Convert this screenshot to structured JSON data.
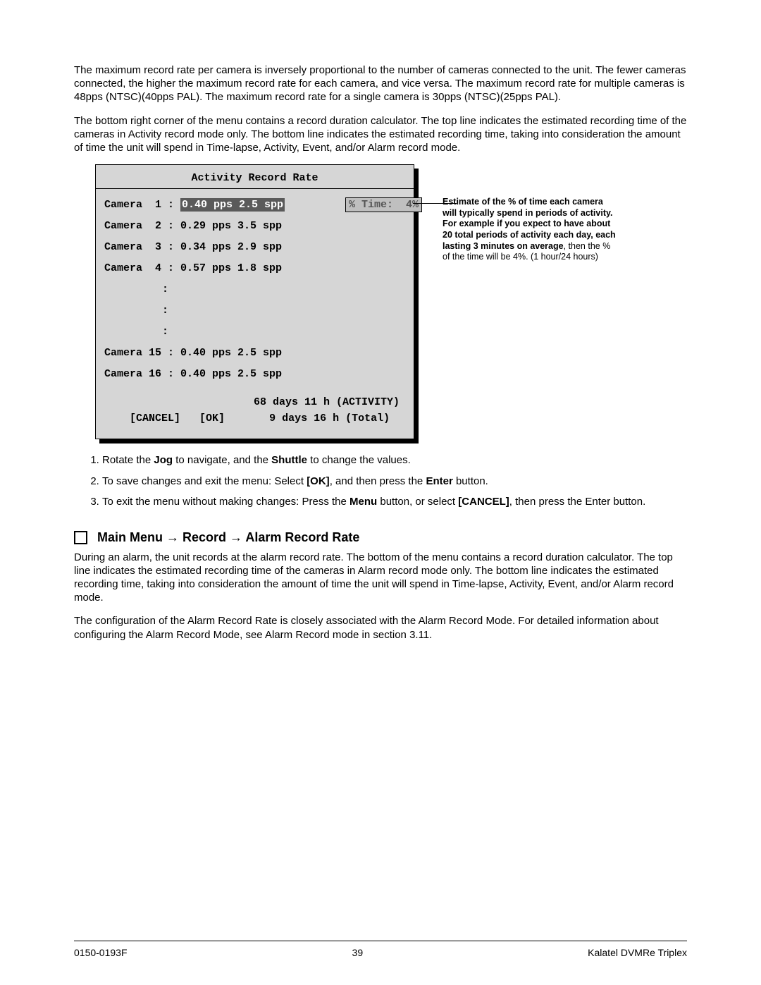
{
  "paragraphs": {
    "p1": "The maximum record rate per camera is inversely proportional to the number of cameras connected to the unit. The fewer cameras connected, the higher the maximum record rate for each camera, and vice versa.  The maximum record rate for multiple cameras is 48pps (NTSC)(40pps PAL).  The maximum record rate for a single camera is 30pps (NTSC)(25pps PAL).",
    "p2": "The bottom right corner of the menu contains a record duration calculator.  The top line indicates the estimated recording time of the cameras in Activity record mode only.  The bottom line indicates the estimated recording time, taking into consideration the amount of time the unit will spend in Time-lapse, Activity, Event, and/or Alarm record mode.",
    "p3": "During an alarm, the unit records at the alarm record rate. The bottom of the menu contains a record duration calculator.  The top line indicates the estimated recording time of the cameras in Alarm record mode only. The bottom line indicates the estimated recording time, taking into consideration the amount of time the unit will spend in Time-lapse, Activity, Event, and/or Alarm record mode.",
    "p4": "The configuration of the Alarm Record Rate is closely associated with the Alarm Record Mode.  For detailed information about configuring the Alarm Record Mode, see Alarm Record mode in section 3.11."
  },
  "menu": {
    "title": "Activity Record Rate",
    "rows": [
      {
        "label": "Camera  1 :",
        "values": "0.40 pps 2.5 spp",
        "highlight": true,
        "time_box": "% Time:  4%"
      },
      {
        "label": "Camera  2 :",
        "values": "0.29 pps 3.5 spp"
      },
      {
        "label": "Camera  3 :",
        "values": "0.34 pps 2.9 spp"
      },
      {
        "label": "Camera  4 :",
        "values": "0.57 pps 1.8 spp"
      }
    ],
    "colons": [
      ":",
      ":",
      ":"
    ],
    "rows_tail": [
      {
        "label": "Camera 15 :",
        "values": "0.40 pps 2.5 spp"
      },
      {
        "label": "Camera 16 :",
        "values": "0.40 pps 2.5 spp"
      }
    ],
    "footer": {
      "activity_line": "68 days 11 h (ACTIVITY)",
      "cancel_label": "[CANCEL]",
      "ok_label": "[OK]",
      "total_line": "9 days 16 h (Total)"
    }
  },
  "annotation": {
    "bold1": "Estimate of the % of time each camera will typically spend in periods of activity. For example if you expect to have about 20 total periods of activity each day, each lasting 3 minutes on average",
    "plain": ", then the % of the time will be 4%. (1 hour/24 hours)"
  },
  "instructions": [
    {
      "pre": "Rotate the ",
      "b1": "Jog",
      "mid": " to navigate, and the ",
      "b2": "Shuttle",
      "post": " to change the values."
    },
    {
      "pre": "To save changes and exit the menu:  Select ",
      "b1": "[OK]",
      "mid": ", and then press the ",
      "b2": "Enter",
      "post": " button."
    },
    {
      "pre": "To exit the menu without making changes:  Press the ",
      "b1": "Menu",
      "mid": " button, or select ",
      "b2": "[CANCEL]",
      "post": ", then press the Enter button."
    }
  ],
  "section_head": "Main Menu → Record → Alarm Record Rate",
  "footer": {
    "doc_id": "0150-0193F",
    "page_num": "39",
    "product": "Kalatel DVMRe Triplex"
  }
}
